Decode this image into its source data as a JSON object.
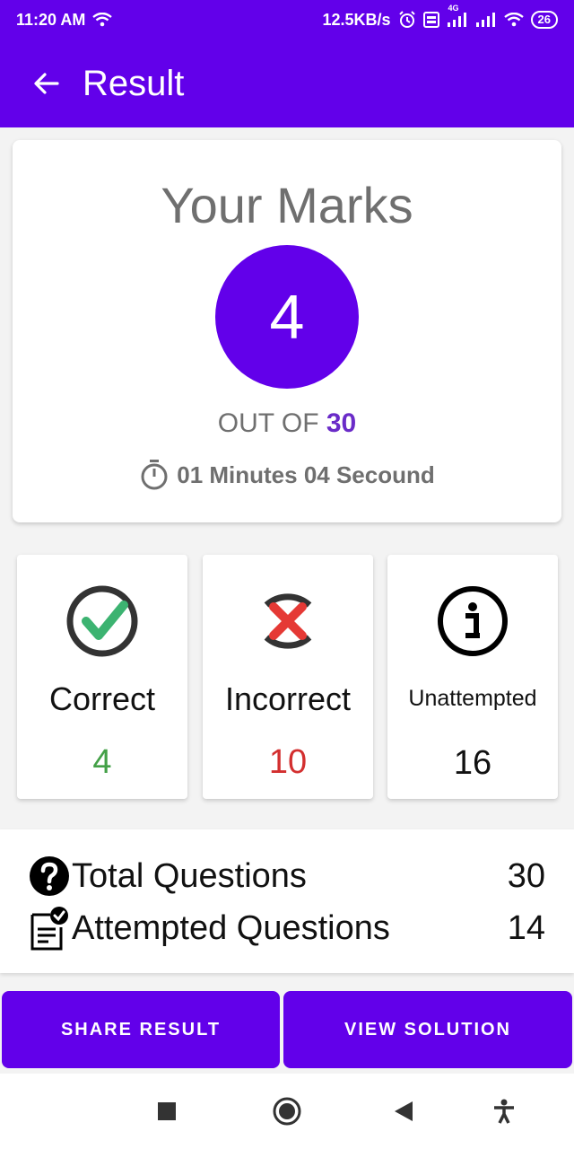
{
  "status_bar": {
    "time": "11:20 AM",
    "speed": "12.5KB/s",
    "network_tag": "4G",
    "battery": "26"
  },
  "app_bar": {
    "title": "Result"
  },
  "marks": {
    "title": "Your Marks",
    "score": "4",
    "out_of_label": "OUT OF",
    "total": "30",
    "time_taken": "01 Minutes 04 Secound"
  },
  "stats": [
    {
      "label": "Correct",
      "value": "4",
      "color": "#43a047"
    },
    {
      "label": "Incorrect",
      "value": "10",
      "color": "#d32f2f"
    },
    {
      "label": "Unattempted",
      "value": "16",
      "color": "#111111"
    }
  ],
  "totals": [
    {
      "label": "Total Questions",
      "value": "30"
    },
    {
      "label": "Attempted Questions",
      "value": "14"
    }
  ],
  "buttons": {
    "share": "SHARE RESULT",
    "solution": "VIEW SOLUTION"
  },
  "colors": {
    "primary": "#6200ea",
    "correct": "#43a047",
    "incorrect": "#d32f2f"
  }
}
